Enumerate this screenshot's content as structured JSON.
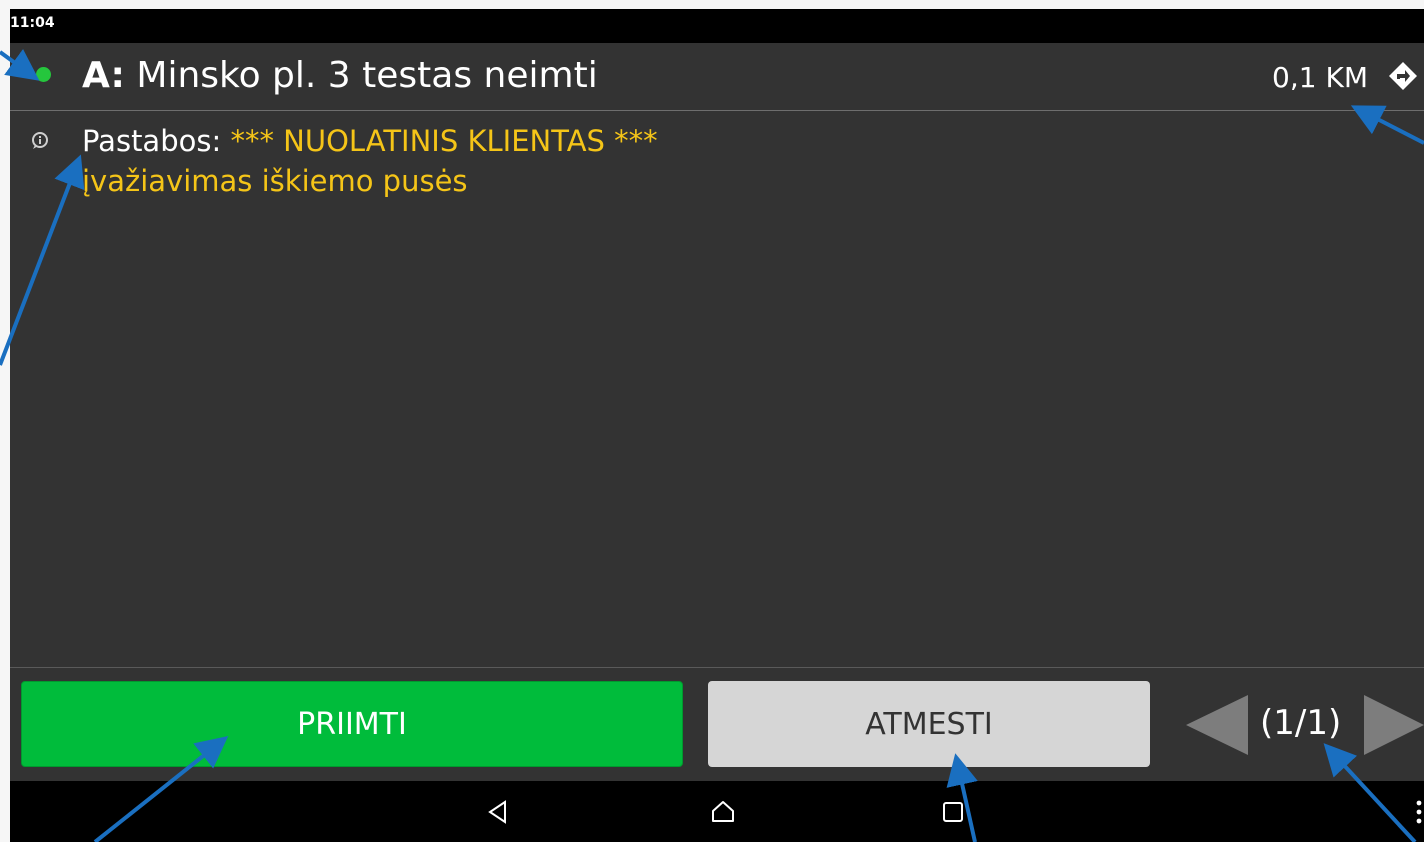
{
  "status_bar": {
    "time": "11:04"
  },
  "header": {
    "label": "A:",
    "address": "Minsko pl. 3 testas neimti",
    "distance": "0,1 KM",
    "status_color": "#25c63d"
  },
  "notes": {
    "title": "Pastabos:",
    "line1": "*** NUOLATINIS KLIENTAS ***",
    "line2": "įvažiavimas iškiemo pusės"
  },
  "actions": {
    "accept_label": "PRIIMTI",
    "reject_label": "ATMESTI",
    "accept_color": "#00bc3b",
    "reject_color": "#d6d6d6"
  },
  "pager": {
    "text": "(1/1)"
  },
  "icons": {
    "status": "green-dot-icon",
    "navigation": "navigation-diamond-icon",
    "info": "info-icon",
    "prev": "triangle-left-icon",
    "next": "triangle-right-icon",
    "back": "back-triangle-icon",
    "home": "home-icon",
    "recents": "square-icon",
    "menu": "overflow-menu-icon"
  },
  "annotation_color": "#1a6fc0"
}
